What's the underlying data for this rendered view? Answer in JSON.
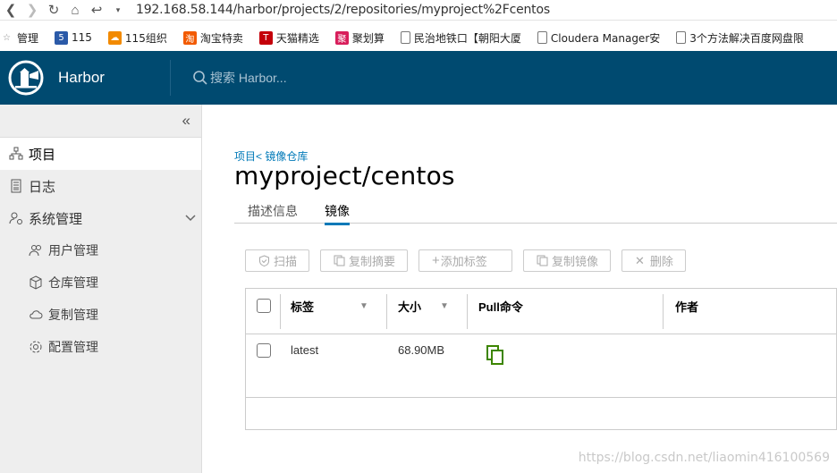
{
  "browser": {
    "url": "192.168.58.144/harbor/projects/2/repositories/myproject%2Fcentos",
    "bookmarks": [
      "管理",
      "115",
      "115组织",
      "淘宝特卖",
      "天猫精选",
      "聚划算",
      "民治地铁口【朝阳大厦",
      "Cloudera Manager安",
      "3个方法解决百度网盘限"
    ]
  },
  "header": {
    "brand": "Harbor",
    "search_placeholder": "搜索 Harbor..."
  },
  "sidebar": {
    "items": [
      {
        "label": "项目"
      },
      {
        "label": "日志"
      },
      {
        "label": "系统管理"
      }
    ],
    "sub_items": [
      {
        "label": "用户管理"
      },
      {
        "label": "仓库管理"
      },
      {
        "label": "复制管理"
      },
      {
        "label": "配置管理"
      }
    ]
  },
  "main": {
    "breadcrumb": "项目< 镜像仓库",
    "title": "myproject/centos",
    "tabs": [
      {
        "label": "描述信息"
      },
      {
        "label": "镜像"
      }
    ],
    "toolbar": {
      "scan": "扫描",
      "copy_digest": "复制摘要",
      "add_label": "添加标签",
      "copy_image": "复制镜像",
      "delete": "删除"
    },
    "table": {
      "headers": {
        "tag": "标签",
        "size": "大小",
        "pull": "Pull命令",
        "author": "作者"
      },
      "rows": [
        {
          "tag": "latest",
          "size": "68.90MB",
          "pull_icon": "copy-icon"
        }
      ]
    }
  },
  "watermark": "https://blog.csdn.net/liaomin416100569",
  "colors": {
    "header_bg": "#004a70",
    "accent": "#0079b8",
    "copy_green": "#3c8500"
  }
}
